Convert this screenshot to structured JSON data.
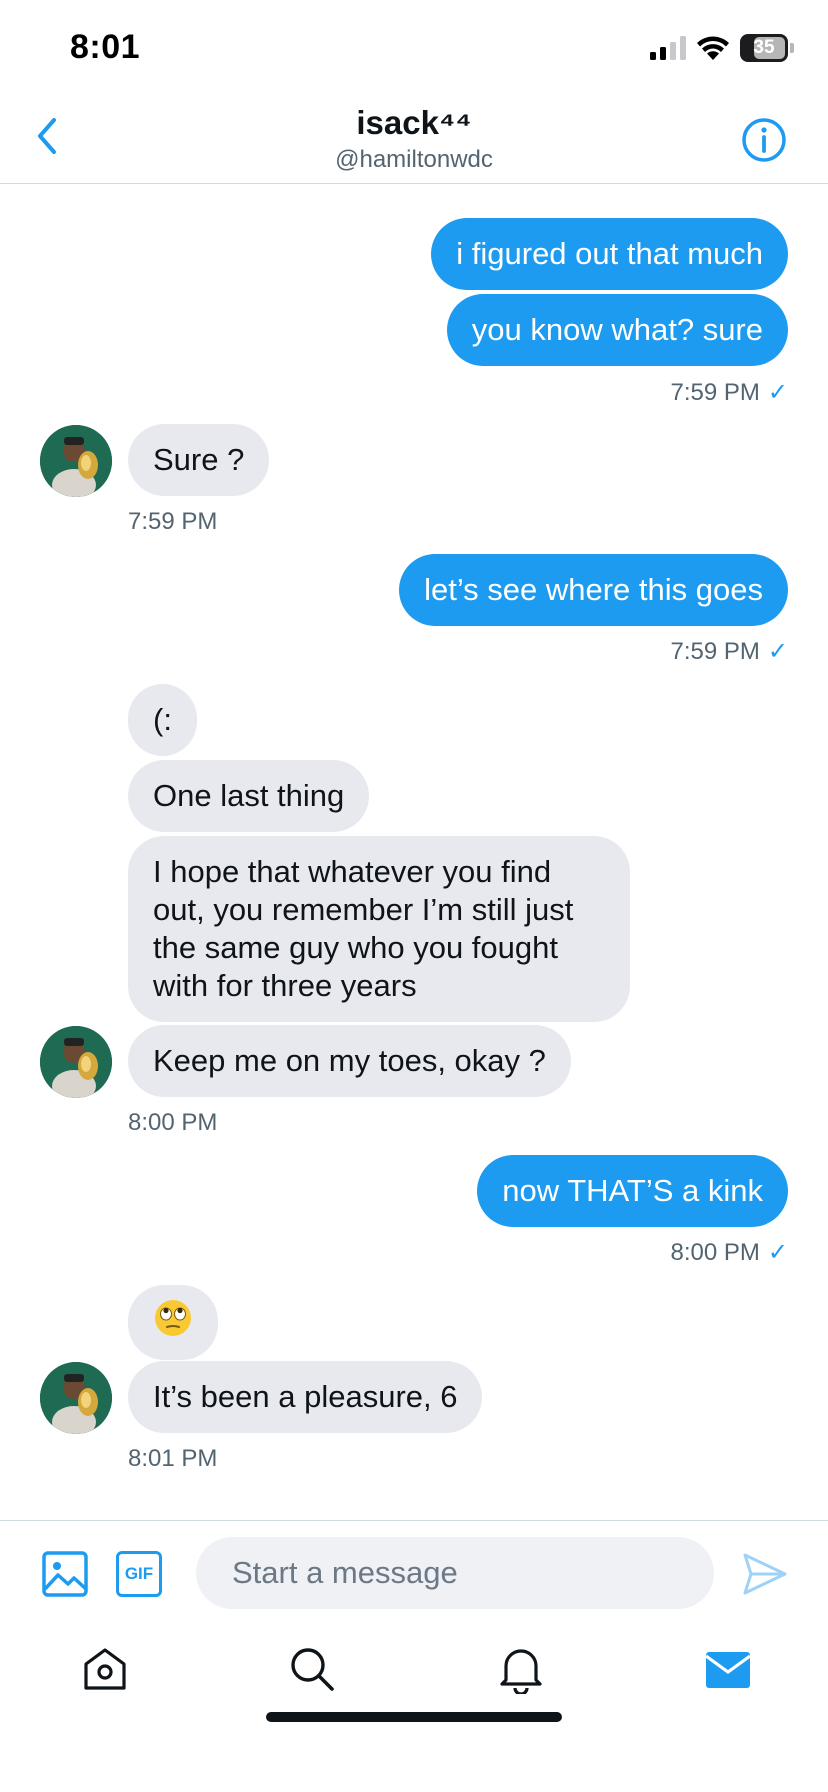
{
  "status_bar": {
    "time": "8:01",
    "battery": "35"
  },
  "header": {
    "title": "isack⁴⁴",
    "handle": "@hamiltonwdc"
  },
  "messages": [
    {
      "text": "i figured out that much"
    },
    {
      "text": "you know what? sure"
    },
    {
      "time": "7:59 PM"
    },
    {
      "text": "Sure ?"
    },
    {
      "time": "7:59 PM"
    },
    {
      "text": "let’s see where this goes"
    },
    {
      "time": "7:59 PM"
    },
    {
      "text": "(:"
    },
    {
      "text": "One last thing"
    },
    {
      "text": "I hope that whatever you find out, you remember I’m still just the same guy who you fought with for three years"
    },
    {
      "text": "Keep me on my toes, okay ?"
    },
    {
      "time": "8:00 PM"
    },
    {
      "text": "now THAT’S a kink"
    },
    {
      "time": "8:00 PM"
    },
    {
      "emoji": "eye-roll-emoji"
    },
    {
      "text": "It’s been a pleasure, 6"
    },
    {
      "time": "8:01 PM"
    }
  ],
  "read_check": "✓",
  "composer": {
    "placeholder": "Start a message",
    "gif_label": "GIF"
  },
  "colors": {
    "accent": "#1d9bf0",
    "incoming_bubble": "#e7e9ee",
    "muted_text": "#536471"
  }
}
